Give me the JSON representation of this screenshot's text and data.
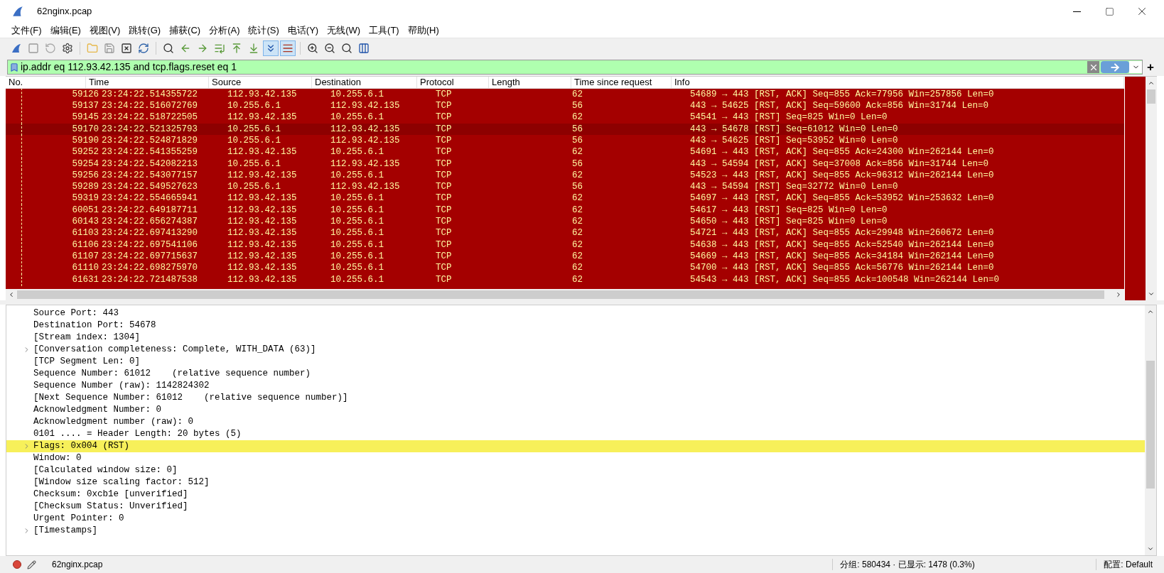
{
  "window": {
    "title": "62nginx.pcap"
  },
  "menu": [
    "文件(F)",
    "编辑(E)",
    "视图(V)",
    "跳转(G)",
    "捕获(C)",
    "分析(A)",
    "统计(S)",
    "电话(Y)",
    "无线(W)",
    "工具(T)",
    "帮助(H)"
  ],
  "toolbar": [
    {
      "kind": "fin",
      "pressed": false
    },
    {
      "kind": "stop",
      "pressed": false
    },
    {
      "kind": "restart",
      "pressed": false
    },
    {
      "kind": "options",
      "pressed": false
    },
    {
      "kind": "sep"
    },
    {
      "kind": "open",
      "pressed": false
    },
    {
      "kind": "save",
      "pressed": false
    },
    {
      "kind": "close",
      "pressed": false
    },
    {
      "kind": "reload",
      "pressed": false
    },
    {
      "kind": "sep"
    },
    {
      "kind": "find",
      "pressed": false
    },
    {
      "kind": "back",
      "pressed": false
    },
    {
      "kind": "forward",
      "pressed": false
    },
    {
      "kind": "goto",
      "pressed": false
    },
    {
      "kind": "first",
      "pressed": false
    },
    {
      "kind": "last",
      "pressed": false
    },
    {
      "kind": "autoscroll",
      "pressed": true
    },
    {
      "kind": "colorize",
      "pressed": true
    },
    {
      "kind": "sep"
    },
    {
      "kind": "zoom-in",
      "pressed": false
    },
    {
      "kind": "zoom-out",
      "pressed": false
    },
    {
      "kind": "zoom-reset",
      "pressed": false
    },
    {
      "kind": "resize",
      "pressed": false
    }
  ],
  "filter": {
    "value": "ip.addr eq 112.93.42.135 and tcp.flags.reset eq 1",
    "add_label": "+"
  },
  "packet_list": {
    "columns": [
      "No.",
      "Time",
      "Source",
      "Destination",
      "Protocol",
      "Length",
      "Time since request",
      "Info"
    ],
    "rows": [
      {
        "no": "59126",
        "time": "23:24:22.514355722",
        "source": "112.93.42.135",
        "destination": "10.255.6.1",
        "protocol": "TCP",
        "length": "62",
        "info": "54689 → 443 [RST, ACK] Seq=855 Ack=77956 Win=257856 Len=0",
        "selected": false
      },
      {
        "no": "59137",
        "time": "23:24:22.516072769",
        "source": "10.255.6.1",
        "destination": "112.93.42.135",
        "protocol": "TCP",
        "length": "56",
        "info": "443 → 54625 [RST, ACK] Seq=59600 Ack=856 Win=31744 Len=0",
        "selected": false
      },
      {
        "no": "59145",
        "time": "23:24:22.518722505",
        "source": "112.93.42.135",
        "destination": "10.255.6.1",
        "protocol": "TCP",
        "length": "62",
        "info": "54541 → 443 [RST] Seq=825 Win=0 Len=0",
        "selected": false
      },
      {
        "no": "59170",
        "time": "23:24:22.521325793",
        "source": "10.255.6.1",
        "destination": "112.93.42.135",
        "protocol": "TCP",
        "length": "56",
        "info": "443 → 54678 [RST] Seq=61012 Win=0 Len=0",
        "selected": true
      },
      {
        "no": "59190",
        "time": "23:24:22.524871829",
        "source": "10.255.6.1",
        "destination": "112.93.42.135",
        "protocol": "TCP",
        "length": "56",
        "info": "443 → 54625 [RST] Seq=53952 Win=0 Len=0",
        "selected": false
      },
      {
        "no": "59252",
        "time": "23:24:22.541355259",
        "source": "112.93.42.135",
        "destination": "10.255.6.1",
        "protocol": "TCP",
        "length": "62",
        "info": "54691 → 443 [RST, ACK] Seq=855 Ack=24300 Win=262144 Len=0",
        "selected": false
      },
      {
        "no": "59254",
        "time": "23:24:22.542082213",
        "source": "10.255.6.1",
        "destination": "112.93.42.135",
        "protocol": "TCP",
        "length": "56",
        "info": "443 → 54594 [RST, ACK] Seq=37008 Ack=856 Win=31744 Len=0",
        "selected": false
      },
      {
        "no": "59256",
        "time": "23:24:22.543077157",
        "source": "112.93.42.135",
        "destination": "10.255.6.1",
        "protocol": "TCP",
        "length": "62",
        "info": "54523 → 443 [RST, ACK] Seq=855 Ack=96312 Win=262144 Len=0",
        "selected": false
      },
      {
        "no": "59289",
        "time": "23:24:22.549527623",
        "source": "10.255.6.1",
        "destination": "112.93.42.135",
        "protocol": "TCP",
        "length": "56",
        "info": "443 → 54594 [RST] Seq=32772 Win=0 Len=0",
        "selected": false
      },
      {
        "no": "59319",
        "time": "23:24:22.554665941",
        "source": "112.93.42.135",
        "destination": "10.255.6.1",
        "protocol": "TCP",
        "length": "62",
        "info": "54697 → 443 [RST, ACK] Seq=855 Ack=53952 Win=253632 Len=0",
        "selected": false
      },
      {
        "no": "60051",
        "time": "23:24:22.649187711",
        "source": "112.93.42.135",
        "destination": "10.255.6.1",
        "protocol": "TCP",
        "length": "62",
        "info": "54617 → 443 [RST] Seq=825 Win=0 Len=0",
        "selected": false
      },
      {
        "no": "60143",
        "time": "23:24:22.656274387",
        "source": "112.93.42.135",
        "destination": "10.255.6.1",
        "protocol": "TCP",
        "length": "62",
        "info": "54650 → 443 [RST] Seq=825 Win=0 Len=0",
        "selected": false
      },
      {
        "no": "61103",
        "time": "23:24:22.697413290",
        "source": "112.93.42.135",
        "destination": "10.255.6.1",
        "protocol": "TCP",
        "length": "62",
        "info": "54721 → 443 [RST, ACK] Seq=855 Ack=29948 Win=260672 Len=0",
        "selected": false
      },
      {
        "no": "61106",
        "time": "23:24:22.697541106",
        "source": "112.93.42.135",
        "destination": "10.255.6.1",
        "protocol": "TCP",
        "length": "62",
        "info": "54638 → 443 [RST, ACK] Seq=855 Ack=52540 Win=262144 Len=0",
        "selected": false
      },
      {
        "no": "61107",
        "time": "23:24:22.697715637",
        "source": "112.93.42.135",
        "destination": "10.255.6.1",
        "protocol": "TCP",
        "length": "62",
        "info": "54669 → 443 [RST, ACK] Seq=855 Ack=34184 Win=262144 Len=0",
        "selected": false
      },
      {
        "no": "61110",
        "time": "23:24:22.698275970",
        "source": "112.93.42.135",
        "destination": "10.255.6.1",
        "protocol": "TCP",
        "length": "62",
        "info": "54700 → 443 [RST, ACK] Seq=855 Ack=56776 Win=262144 Len=0",
        "selected": false
      },
      {
        "no": "61631",
        "time": "23:24:22.721487538",
        "source": "112.93.42.135",
        "destination": "10.255.6.1",
        "protocol": "TCP",
        "length": "62",
        "info": "54543 → 443 [RST, ACK] Seq=855 Ack=100548 Win=262144 Len=0",
        "selected": false
      }
    ]
  },
  "details": [
    {
      "text": "Source Port: 443",
      "expandable": false,
      "selected": false
    },
    {
      "text": "Destination Port: 54678",
      "expandable": false,
      "selected": false
    },
    {
      "text": "[Stream index: 1304]",
      "expandable": false,
      "selected": false
    },
    {
      "text": "[Conversation completeness: Complete, WITH_DATA (63)]",
      "expandable": true,
      "selected": false
    },
    {
      "text": "[TCP Segment Len: 0]",
      "expandable": false,
      "selected": false
    },
    {
      "text": "Sequence Number: 61012    (relative sequence number)",
      "expandable": false,
      "selected": false
    },
    {
      "text": "Sequence Number (raw): 1142824302",
      "expandable": false,
      "selected": false
    },
    {
      "text": "[Next Sequence Number: 61012    (relative sequence number)]",
      "expandable": false,
      "selected": false
    },
    {
      "text": "Acknowledgment Number: 0",
      "expandable": false,
      "selected": false
    },
    {
      "text": "Acknowledgment number (raw): 0",
      "expandable": false,
      "selected": false
    },
    {
      "text": "0101 .... = Header Length: 20 bytes (5)",
      "expandable": false,
      "selected": false
    },
    {
      "text": "Flags: 0x004 (RST)",
      "expandable": true,
      "selected": true
    },
    {
      "text": "Window: 0",
      "expandable": false,
      "selected": false
    },
    {
      "text": "[Calculated window size: 0]",
      "expandable": false,
      "selected": false
    },
    {
      "text": "[Window size scaling factor: 512]",
      "expandable": false,
      "selected": false
    },
    {
      "text": "Checksum: 0xcb1e [unverified]",
      "expandable": false,
      "selected": false
    },
    {
      "text": "[Checksum Status: Unverified]",
      "expandable": false,
      "selected": false
    },
    {
      "text": "Urgent Pointer: 0",
      "expandable": false,
      "selected": false
    },
    {
      "text": "[Timestamps]",
      "expandable": true,
      "selected": false
    }
  ],
  "status_bar": {
    "file": "62nginx.pcap",
    "packets": "分组: 580434 · 已显示: 1478 (0.3%)",
    "profile": "配置: Default"
  }
}
